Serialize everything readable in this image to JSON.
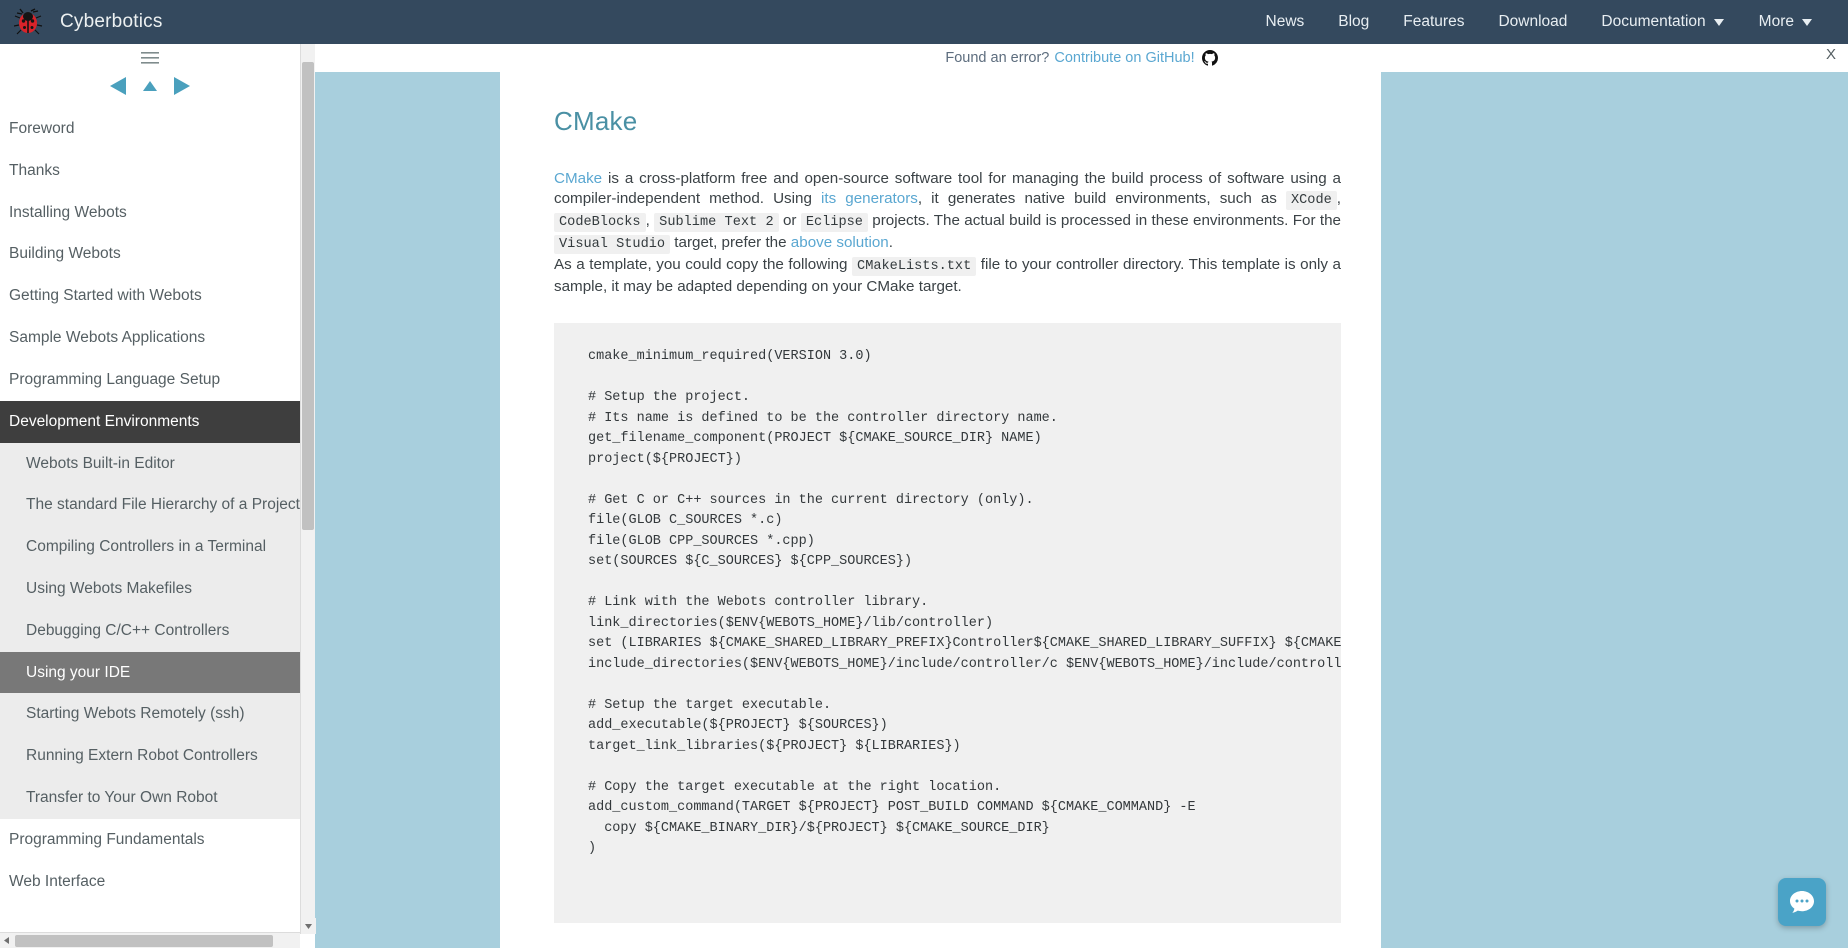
{
  "topnav": {
    "brand": "Cyberbotics",
    "logo_icon": "ladybug-logo-icon",
    "items": [
      {
        "label": "News",
        "caret": false
      },
      {
        "label": "Blog",
        "caret": false
      },
      {
        "label": "Features",
        "caret": false
      },
      {
        "label": "Download",
        "caret": false
      },
      {
        "label": "Documentation",
        "caret": true
      },
      {
        "label": "More",
        "caret": true
      }
    ]
  },
  "banner": {
    "text": "Found an error?",
    "link_label": "Contribute on GitHub!",
    "github_icon": "github-icon",
    "close_label": "X"
  },
  "sidebar": {
    "menu_icon": "hamburger-menu-icon",
    "nav_prev_icon": "arrow-left-icon",
    "nav_up_icon": "arrow-up-icon",
    "nav_next_icon": "arrow-right-icon",
    "items": [
      {
        "label": "Foreword",
        "level": 1,
        "selected": false
      },
      {
        "label": "Thanks",
        "level": 1,
        "selected": false
      },
      {
        "label": "Installing Webots",
        "level": 1,
        "selected": false
      },
      {
        "label": "Building Webots",
        "level": 1,
        "selected": false
      },
      {
        "label": "Getting Started with Webots",
        "level": 1,
        "selected": false
      },
      {
        "label": "Sample Webots Applications",
        "level": 1,
        "selected": false
      },
      {
        "label": "Programming Language Setup",
        "level": 1,
        "selected": false
      },
      {
        "label": "Development Environments",
        "level": 1,
        "selected": true
      },
      {
        "label": "Webots Built-in Editor",
        "level": 2,
        "selected": false
      },
      {
        "label": "The standard File Hierarchy of a Project",
        "level": 2,
        "selected": false
      },
      {
        "label": "Compiling Controllers in a Terminal",
        "level": 2,
        "selected": false
      },
      {
        "label": "Using Webots Makefiles",
        "level": 2,
        "selected": false
      },
      {
        "label": "Debugging C/C++ Controllers",
        "level": 2,
        "selected": false
      },
      {
        "label": "Using your IDE",
        "level": 2,
        "selected": true
      },
      {
        "label": "Starting Webots Remotely (ssh)",
        "level": 2,
        "selected": false
      },
      {
        "label": "Running Extern Robot Controllers",
        "level": 2,
        "selected": false
      },
      {
        "label": "Transfer to Your Own Robot",
        "level": 2,
        "selected": false
      },
      {
        "label": "Programming Fundamentals",
        "level": 1,
        "selected": false
      },
      {
        "label": "Web Interface",
        "level": 1,
        "selected": false
      }
    ]
  },
  "doc": {
    "title": "CMake",
    "p1_link_cmake": "CMake",
    "p1_a": " is a cross-platform free and open-source software tool for managing the build process of software using a compiler-independent method. Using ",
    "p1_link_generators": "its generators",
    "p1_b": ", it generates native build environments, such as ",
    "code_xcode": "XCode",
    "p1_c": ", ",
    "code_codeblocks": "CodeBlocks",
    "p1_d": ", ",
    "code_sublime": "Sublime Text 2",
    "p1_e": " or ",
    "code_eclipse": "Eclipse",
    "p1_f": " projects. The actual build is processed in these environments. For the ",
    "code_vs": "Visual Studio",
    "p1_g": " target, prefer the ",
    "p1_link_above": "above solution",
    "p1_h": ".",
    "p2_a": "As a template, you could copy the following ",
    "code_cmakelists": "CMakeLists.txt",
    "p2_b": " file to your controller directory. This template is only a sample, it may be adapted depending on your CMake target.",
    "code_block": "cmake_minimum_required(VERSION 3.0)\n\n# Setup the project.\n# Its name is defined to be the controller directory name.\nget_filename_component(PROJECT ${CMAKE_SOURCE_DIR} NAME)\nproject(${PROJECT})\n\n# Get C or C++ sources in the current directory (only).\nfile(GLOB C_SOURCES *.c)\nfile(GLOB CPP_SOURCES *.cpp)\nset(SOURCES ${C_SOURCES} ${CPP_SOURCES})\n\n# Link with the Webots controller library.\nlink_directories($ENV{WEBOTS_HOME}/lib/controller)\nset (LIBRARIES ${CMAKE_SHARED_LIBRARY_PREFIX}Controller${CMAKE_SHARED_LIBRARY_SUFFIX} ${CMAKE_SHARED_LIBRARY_PREFIX}CppController${CMAKE_SHARED_LIBRARY_SUFFIX})\ninclude_directories($ENV{WEBOTS_HOME}/include/controller/c $ENV{WEBOTS_HOME}/include/controller/cpp)\n\n# Setup the target executable.\nadd_executable(${PROJECT} ${SOURCES})\ntarget_link_libraries(${PROJECT} ${LIBRARIES})\n\n# Copy the target executable at the right location.\nadd_custom_command(TARGET ${PROJECT} POST_BUILD COMMAND ${CMAKE_COMMAND} -E\n  copy ${CMAKE_BINARY_DIR}/${PROJECT} ${CMAKE_SOURCE_DIR}\n)"
  },
  "chat": {
    "icon": "chat-bubble-icon"
  },
  "colors": {
    "navbar_bg": "#34495e",
    "accent_link": "#5aa7d1",
    "selected_level1_bg": "#3e3e3e",
    "selected_level2_bg": "#787878",
    "submenu_bg": "#ececec",
    "page_frame_blue": "#a8cfdd",
    "code_bg": "#f0f0f0",
    "title_color": "#4a90a4",
    "chat_bg": "#4aa3c7"
  }
}
